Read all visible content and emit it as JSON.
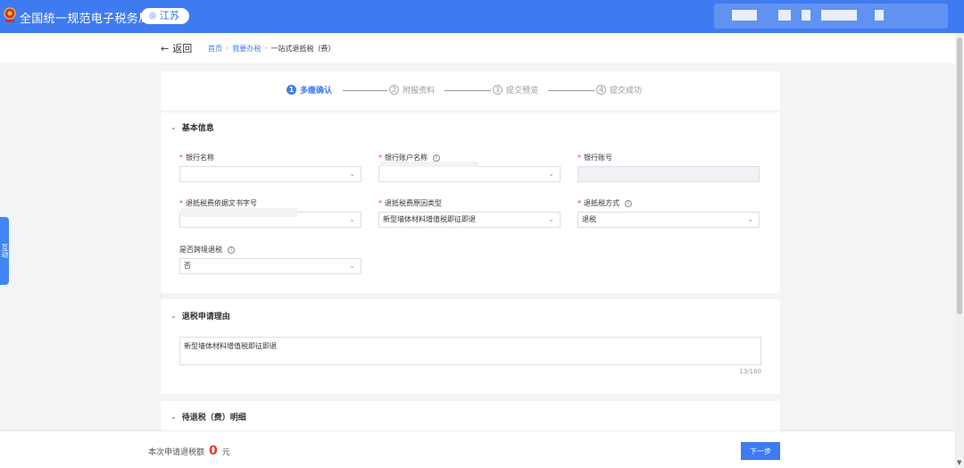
{
  "header": {
    "title": "全国统一规范电子税务局",
    "region": "江苏",
    "emblem_icon": "tax-emblem-icon",
    "brand_color": "#3f7bf0"
  },
  "breadcrumb": {
    "back_label": "返回",
    "items": [
      "首页",
      "我要办税",
      "一站式退抵税（费）"
    ]
  },
  "steps": [
    {
      "num": "1",
      "label": "多缴确认",
      "active": true
    },
    {
      "num": "2",
      "label": "附报资料",
      "active": false
    },
    {
      "num": "3",
      "label": "提交预览",
      "active": false
    },
    {
      "num": "4",
      "label": "提交成功",
      "active": false
    }
  ],
  "basic_info": {
    "title": "基本信息",
    "fields": {
      "bank_name": {
        "label": "银行名称",
        "value": ""
      },
      "bank_account_name": {
        "label": "银行账户名称",
        "value": ""
      },
      "bank_account_no": {
        "label": "银行账号",
        "value": ""
      },
      "refund_doc_no": {
        "label": "退抵税费依据文书字号",
        "value": ""
      },
      "refund_reason_type": {
        "label": "退抵税费原因类型",
        "value": "新型墙体材料增值税即征即退"
      },
      "refund_method": {
        "label": "退抵税方式",
        "value": "退税"
      },
      "cross_region": {
        "label": "是否跨境退税",
        "value": "否"
      }
    }
  },
  "reason": {
    "title": "退税申请理由",
    "text": "新型墙体材料增值税即征即退",
    "counter": "13/160"
  },
  "detail": {
    "title": "待退税（费）明细"
  },
  "footer": {
    "summary_prefix": "本次申请退税额",
    "amount": "0",
    "unit": "元",
    "next_label": "下一步"
  },
  "float_tab": {
    "label": "互动"
  }
}
